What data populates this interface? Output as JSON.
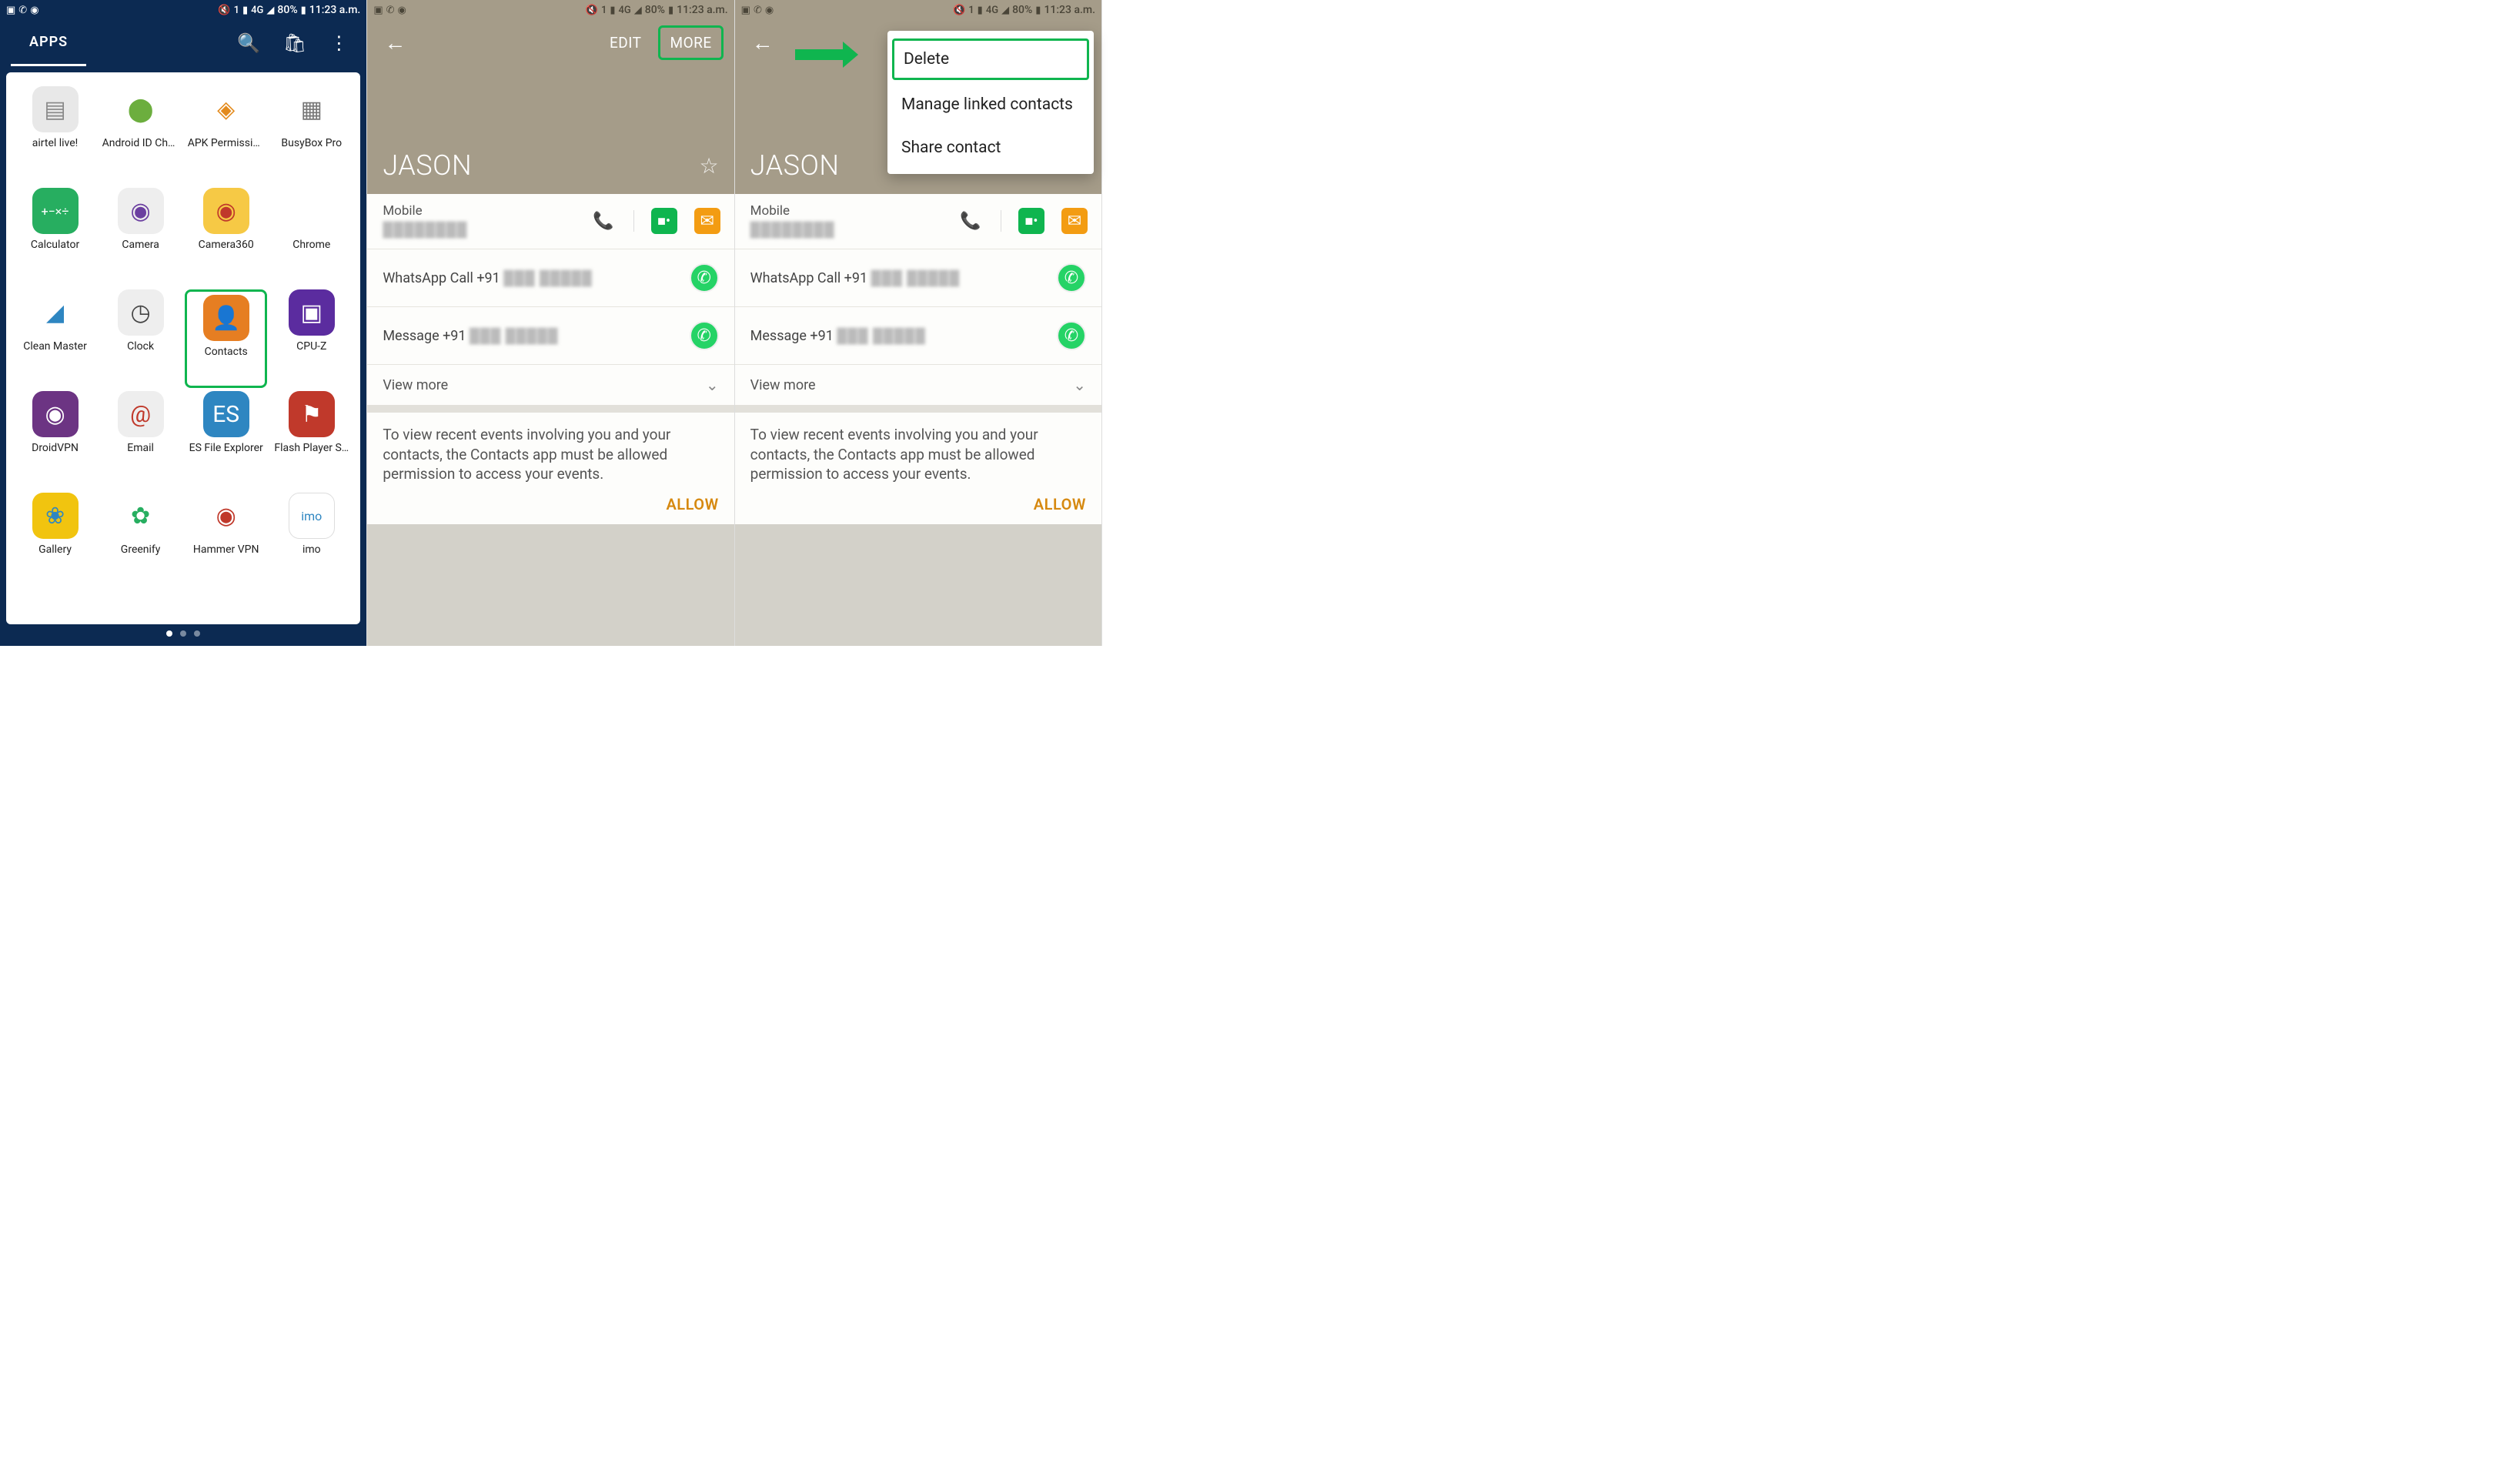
{
  "status": {
    "battery": "80%",
    "network": "4G",
    "time": "11:23 a.m."
  },
  "screen1": {
    "tab": "APPS",
    "apps": [
      {
        "label": "airtel live!",
        "glyph": "▤",
        "cls": "ic-sim"
      },
      {
        "label": "Android ID Cha…",
        "glyph": "⬤",
        "cls": "ic-android"
      },
      {
        "label": "APK Permissio…",
        "glyph": "◈",
        "cls": "ic-apk"
      },
      {
        "label": "BusyBox Pro",
        "glyph": "▦",
        "cls": "ic-busy"
      },
      {
        "label": "Calculator",
        "glyph": "+−×÷",
        "cls": "ic-calc"
      },
      {
        "label": "Camera",
        "glyph": "◉",
        "cls": "ic-cam"
      },
      {
        "label": "Camera360",
        "glyph": "◉",
        "cls": "ic-c360"
      },
      {
        "label": "Chrome",
        "glyph": "◯",
        "cls": "ic-chrome"
      },
      {
        "label": "Clean Master",
        "glyph": "◢",
        "cls": "ic-clean"
      },
      {
        "label": "Clock",
        "glyph": "◷",
        "cls": "ic-clock"
      },
      {
        "label": "Contacts",
        "glyph": "👤",
        "cls": "ic-contacts",
        "highlight": true
      },
      {
        "label": "CPU-Z",
        "glyph": "▣",
        "cls": "ic-cpuz"
      },
      {
        "label": "DroidVPN",
        "glyph": "◉",
        "cls": "ic-dvpn"
      },
      {
        "label": "Email",
        "glyph": "@",
        "cls": "ic-email"
      },
      {
        "label": "ES File Explorer",
        "glyph": "ES",
        "cls": "ic-es"
      },
      {
        "label": "Flash Player S…",
        "glyph": "⚑",
        "cls": "ic-flash"
      },
      {
        "label": "Gallery",
        "glyph": "❀",
        "cls": "ic-gallery"
      },
      {
        "label": "Greenify",
        "glyph": "✿",
        "cls": "ic-green"
      },
      {
        "label": "Hammer VPN",
        "glyph": "◉",
        "cls": "ic-hvpn"
      },
      {
        "label": "imo",
        "glyph": "imo",
        "cls": "ic-imo"
      }
    ]
  },
  "contact": {
    "edit": "EDIT",
    "more": "MORE",
    "name": "JASON",
    "mobile_label": "Mobile",
    "whatsapp_call": "WhatsApp Call +91",
    "whatsapp_msg": "Message +91",
    "view_more": "View more",
    "perm_text": "To view recent events involving you and your contacts, the Contacts app must be allowed permission to access your events.",
    "allow": "ALLOW"
  },
  "menu": {
    "delete": "Delete",
    "linked": "Manage linked contacts",
    "share": "Share contact"
  }
}
